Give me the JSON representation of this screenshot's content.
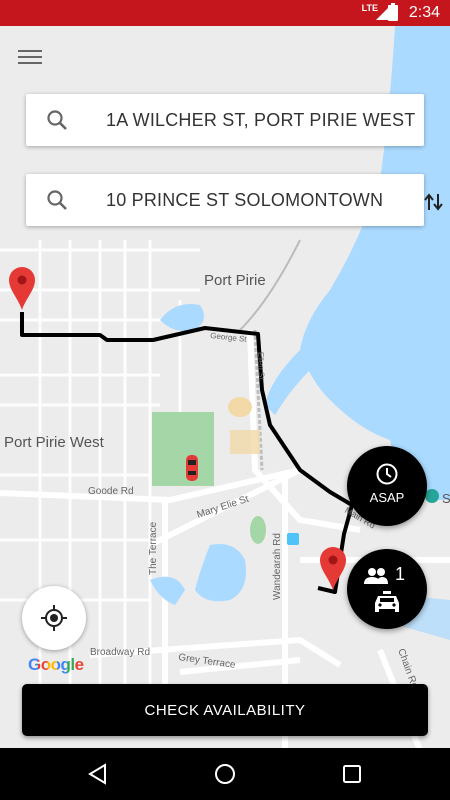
{
  "status_bar": {
    "time": "2:34",
    "network": "LTE"
  },
  "header": {
    "menu_icon": "hamburger-menu-icon"
  },
  "search": {
    "pickup": {
      "icon": "search-icon",
      "value": "1A WILCHER ST, PORT PIRIE WEST"
    },
    "dropoff": {
      "icon": "search-icon",
      "value": "10 PRINCE ST SOLOMONTOWN"
    },
    "swap_icon": "swap-vertical-icon"
  },
  "map": {
    "labels": {
      "port_pirie": "Port Pirie",
      "port_pirie_west": "Port Pirie West",
      "goode_rd": "Goode Rd",
      "mary_elie_st": "Mary Elie St",
      "the_terrace": "The Terrace",
      "wandearah_rd": "Wandearah Rd",
      "broadway_rd": "Broadway Rd",
      "grey_terrace": "Grey Terrace",
      "george_st": "George St",
      "main_rd": "Main Rd",
      "chain_rd": "Chain Rd",
      "ellen_st": "Ellen St",
      "s_label": "S"
    },
    "attribution": "Google",
    "route_color": "#000000",
    "marker_color": "#e53935",
    "car_color": "#e53935",
    "water_color": "#aadaff",
    "park_color": "#a5d6a7"
  },
  "fabs": {
    "asap": {
      "icon": "clock-icon",
      "label": "ASAP"
    },
    "passengers": {
      "icon": "people-icon",
      "count": "1",
      "vehicle_icon": "taxi-icon"
    }
  },
  "locate_button": {
    "icon": "my-location-icon"
  },
  "check_button": {
    "label": "CHECK AVAILABILITY"
  },
  "nav_bar": {
    "back_icon": "back-triangle-icon",
    "home_icon": "home-circle-icon",
    "recents_icon": "recents-square-icon"
  },
  "colors": {
    "status_bar": "#c4161c",
    "button_bg": "#000000",
    "button_text": "#ffffff"
  }
}
